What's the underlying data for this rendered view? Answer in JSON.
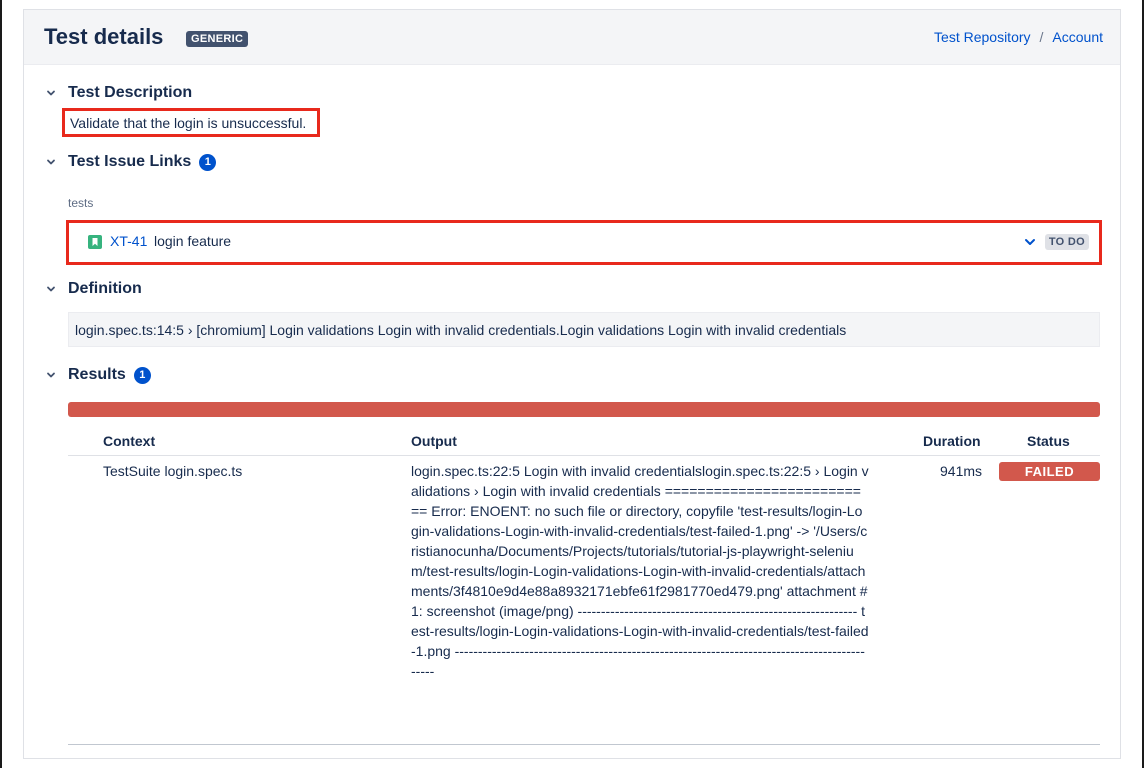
{
  "header": {
    "title": "Test details",
    "type_badge": "GENERIC",
    "breadcrumb": [
      "Test Repository",
      "Account"
    ],
    "breadcrumb_sep": "/"
  },
  "description": {
    "title": "Test Description",
    "text": "Validate that the login is unsuccessful."
  },
  "issue_links": {
    "title": "Test Issue Links",
    "count": "1",
    "relation": "tests",
    "items": [
      {
        "key": "XT-41",
        "summary": "login feature",
        "status": "TO DO",
        "icon": "story-icon"
      }
    ]
  },
  "definition": {
    "title": "Definition",
    "text": "login.spec.ts:14:5 › [chromium] Login validations Login with invalid credentials.Login validations Login with invalid credentials"
  },
  "results": {
    "title": "Results",
    "count": "1",
    "progress_failed_fraction": 1.0,
    "columns": [
      "Context",
      "Output",
      "Duration",
      "Status"
    ],
    "rows": [
      {
        "context": "TestSuite login.spec.ts",
        "output": "login.spec.ts:22:5 Login with invalid credentialslogin.spec.ts:22:5 › Login validations › Login with invalid credentials ========================== Error: ENOENT: no such file or directory, copyfile 'test-results/login-Login-validations-Login-with-invalid-credentials/test-failed-1.png' -> '/Users/cristianocunha/Documents/Projects/tutorials/tutorial-js-playwright-selenium/test-results/login-Login-validations-Login-with-invalid-credentials/attachments/3f4810e9d4e88a8932171ebfe61f2981770ed479.png' attachment #1: screenshot (image/png) ------------------------------------------------------------ test-results/login-Login-validations-Login-with-invalid-credentials/test-failed-1.png ---------------------------------------------------------------------------------------------",
        "duration": "941ms",
        "status": "FAILED"
      }
    ]
  },
  "colors": {
    "accent": "#0052cc",
    "failed": "#d2584c",
    "highlight": "#e8291c",
    "story": "#36b37e"
  }
}
